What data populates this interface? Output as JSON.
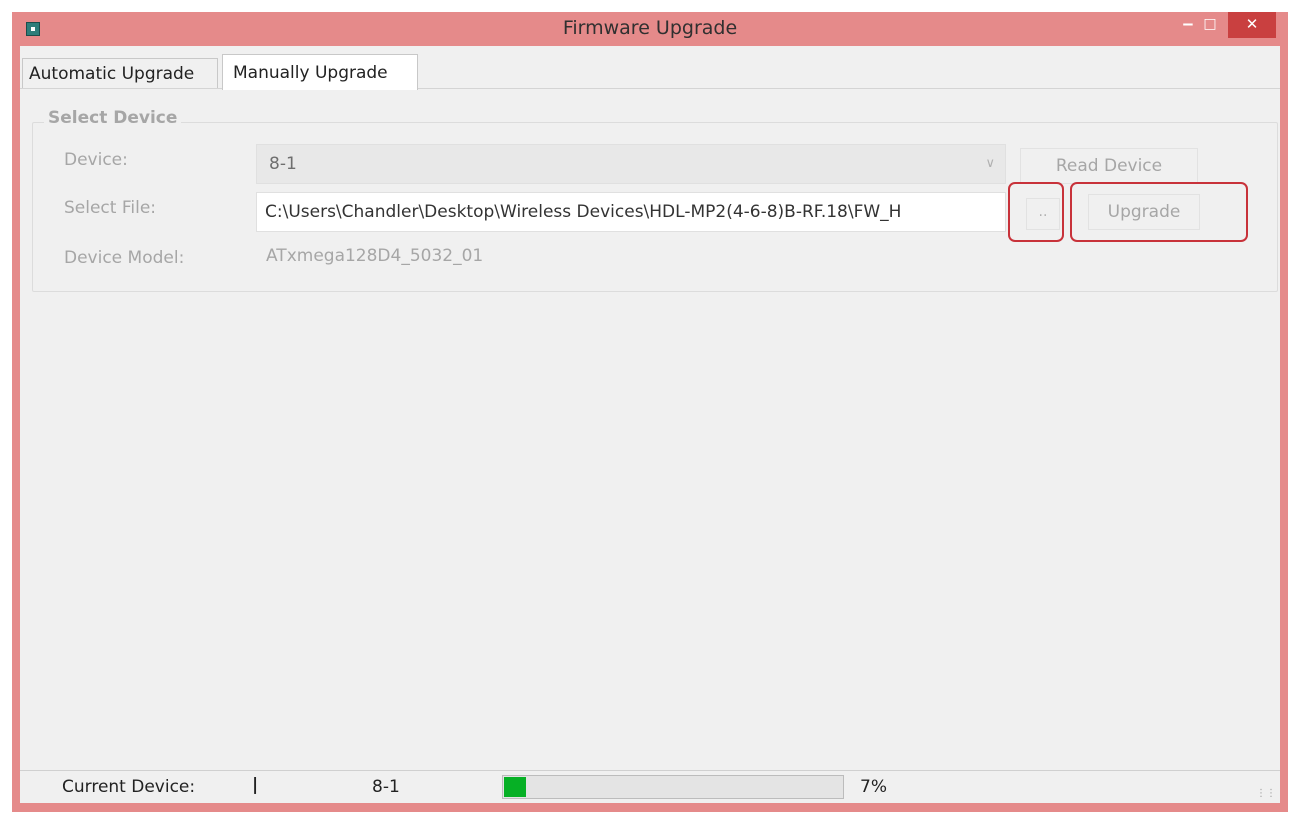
{
  "window": {
    "title": "Firmware Upgrade",
    "controls": {
      "minimize": "‒",
      "maximize": "□",
      "close": "✕"
    },
    "icon": "app-icon"
  },
  "tabs": [
    {
      "label": "Automatic Upgrade",
      "active": false
    },
    {
      "label": "Manually Upgrade",
      "active": true
    }
  ],
  "select_device": {
    "group_title": "Select Device",
    "device_label": "Device:",
    "device_value": "8-1",
    "read_device_label": "Read Device",
    "file_label": "Select File:",
    "file_value": "C:\\Users\\Chandler\\Desktop\\Wireless Devices\\HDL-MP2(4-6-8)B-RF.18\\FW_H",
    "browse_label": "..",
    "upgrade_label": "Upgrade",
    "model_label": "Device Model:",
    "model_value": "ATxmega128D4_5032_01"
  },
  "status": {
    "current_device_label": "Current Device:",
    "separator": "|",
    "current_device_value": "8-1",
    "progress_percent": 7,
    "progress_text": "7%"
  },
  "colors": {
    "title_bar": "#e58a8a",
    "close_button": "#c94040",
    "highlight": "#c8323a",
    "progress_fill": "#06b025"
  }
}
